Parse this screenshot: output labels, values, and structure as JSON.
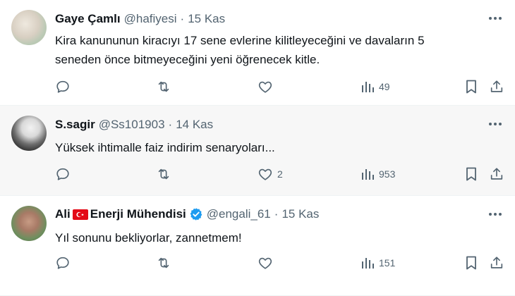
{
  "tweets": [
    {
      "name": "Gaye Çamlı",
      "handle": "@hafiyesi",
      "time": "15 Kas",
      "text_lines": [
        "Kira kanununun kiracıyı 17 sene evlerine kilitleyeceğini ve davaların 5",
        "seneden önce bitmeyeceğini yeni öğrenecek kitle."
      ],
      "likes": "",
      "views": "49"
    },
    {
      "name": "S.sagir",
      "handle": "@Ss101903",
      "time": "14 Kas",
      "text_lines": [
        "Yüksek ihtimalle faiz indirim senaryoları..."
      ],
      "likes": "2",
      "views": "953"
    },
    {
      "name_pre": "Ali",
      "name_post": "Enerji Mühendisi",
      "handle": "@engali_61",
      "time": "15 Kas",
      "text_lines": [
        "Yıl sonunu bekliyorlar, zannetmem!"
      ],
      "likes": "",
      "views": "151",
      "verified": true
    }
  ],
  "separator": "·",
  "icons": {
    "reply": "reply-icon",
    "retweet": "retweet-icon",
    "like": "heart-icon",
    "views": "views-chart-icon",
    "bookmark": "bookmark-icon",
    "share": "share-icon",
    "more": "more-dots-icon",
    "verified": "verified-badge-icon",
    "flag": "turkey-flag-icon"
  },
  "colors": {
    "text": "#0f1419",
    "muted": "#536471",
    "verified": "#1d9bf0",
    "flag": "#e30a17"
  }
}
